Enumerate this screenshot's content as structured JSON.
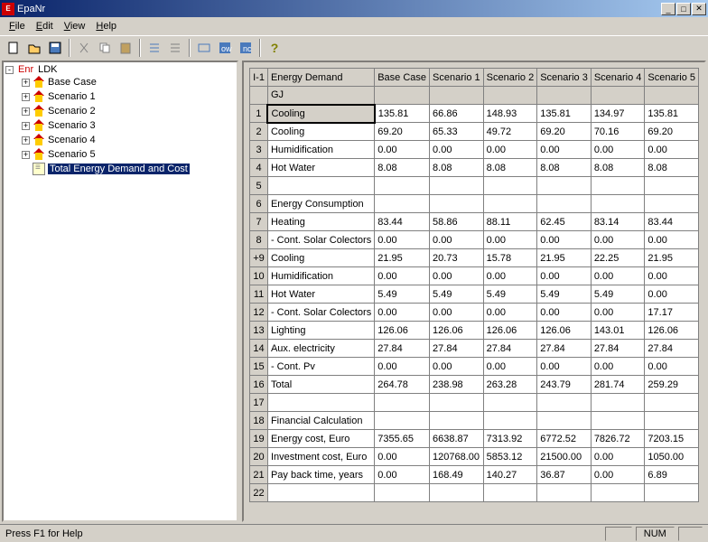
{
  "app_title": "EpaNr",
  "menu": [
    "File",
    "Edit",
    "View",
    "Help"
  ],
  "tree": {
    "root_prefix": "Enr",
    "root_label": "LDK",
    "items": [
      {
        "label": "Base Case",
        "expandable": true
      },
      {
        "label": "Scenario 1",
        "expandable": true
      },
      {
        "label": "Scenario 2",
        "expandable": true
      },
      {
        "label": "Scenario 3",
        "expandable": true
      },
      {
        "label": "Scenario 4",
        "expandable": true
      },
      {
        "label": "Scenario 5",
        "expandable": true
      },
      {
        "label": "Total Energy Demand and Cost",
        "expandable": false,
        "doc": true,
        "selected": true
      }
    ]
  },
  "grid": {
    "corner": "I-1",
    "headers": [
      "Energy Demand",
      "Base Case",
      "Scenario 1",
      "Scenario 2",
      "Scenario 3",
      "Scenario 4",
      "Scenario 5"
    ],
    "unit_row_label": "GJ",
    "rows": [
      {
        "n": "1",
        "cells": [
          "Cooling",
          "135.81",
          "66.86",
          "148.93",
          "135.81",
          "134.97",
          "135.81"
        ],
        "sel": 0
      },
      {
        "n": "2",
        "cells": [
          "Cooling",
          "69.20",
          "65.33",
          "49.72",
          "69.20",
          "70.16",
          "69.20"
        ]
      },
      {
        "n": "3",
        "cells": [
          "Humidification",
          "0.00",
          "0.00",
          "0.00",
          "0.00",
          "0.00",
          "0.00"
        ]
      },
      {
        "n": "4",
        "cells": [
          "Hot Water",
          "8.08",
          "8.08",
          "8.08",
          "8.08",
          "8.08",
          "8.08"
        ]
      },
      {
        "n": "5",
        "cells": [
          "",
          "",
          "",
          "",
          "",
          "",
          ""
        ]
      },
      {
        "n": "6",
        "cells": [
          "Energy Consumption",
          "",
          "",
          "",
          "",
          "",
          ""
        ]
      },
      {
        "n": "7",
        "cells": [
          "Heating",
          "83.44",
          "58.86",
          "88.11",
          "62.45",
          "83.14",
          "83.44"
        ]
      },
      {
        "n": "8",
        "cells": [
          "- Cont. Solar Colectors",
          "0.00",
          "0.00",
          "0.00",
          "0.00",
          "0.00",
          "0.00"
        ]
      },
      {
        "n": "+9",
        "cells": [
          "Cooling",
          "21.95",
          "20.73",
          "15.78",
          "21.95",
          "22.25",
          "21.95"
        ]
      },
      {
        "n": "10",
        "cells": [
          "Humidification",
          "0.00",
          "0.00",
          "0.00",
          "0.00",
          "0.00",
          "0.00"
        ]
      },
      {
        "n": "11",
        "cells": [
          "Hot Water",
          "5.49",
          "5.49",
          "5.49",
          "5.49",
          "5.49",
          "0.00"
        ]
      },
      {
        "n": "12",
        "cells": [
          "- Cont. Solar Colectors",
          "0.00",
          "0.00",
          "0.00",
          "0.00",
          "0.00",
          "17.17"
        ]
      },
      {
        "n": "13",
        "cells": [
          "Lighting",
          "126.06",
          "126.06",
          "126.06",
          "126.06",
          "143.01",
          "126.06"
        ]
      },
      {
        "n": "14",
        "cells": [
          "Aux. electricity",
          "27.84",
          "27.84",
          "27.84",
          "27.84",
          "27.84",
          "27.84"
        ]
      },
      {
        "n": "15",
        "cells": [
          "- Cont. Pv",
          "0.00",
          "0.00",
          "0.00",
          "0.00",
          "0.00",
          "0.00"
        ]
      },
      {
        "n": "16",
        "cells": [
          "Total",
          "264.78",
          "238.98",
          "263.28",
          "243.79",
          "281.74",
          "259.29"
        ]
      },
      {
        "n": "17",
        "cells": [
          "",
          "",
          "",
          "",
          "",
          "",
          ""
        ]
      },
      {
        "n": "18",
        "cells": [
          "Financial Calculation",
          "",
          "",
          "",
          "",
          "",
          ""
        ]
      },
      {
        "n": "19",
        "cells": [
          "Energy cost, Euro",
          "7355.65",
          "6638.87",
          "7313.92",
          "6772.52",
          "7826.72",
          "7203.15"
        ]
      },
      {
        "n": "20",
        "cells": [
          "Investment cost, Euro",
          "0.00",
          "120768.00",
          "5853.12",
          "21500.00",
          "0.00",
          "1050.00"
        ]
      },
      {
        "n": "21",
        "cells": [
          "Pay back time, years",
          "0.00",
          "168.49",
          "140.27",
          "36.87",
          "0.00",
          "6.89"
        ]
      },
      {
        "n": "22",
        "cells": [
          "",
          "",
          "",
          "",
          "",
          "",
          ""
        ]
      }
    ]
  },
  "statusbar": {
    "help": "Press F1 for Help",
    "num": "NUM"
  }
}
